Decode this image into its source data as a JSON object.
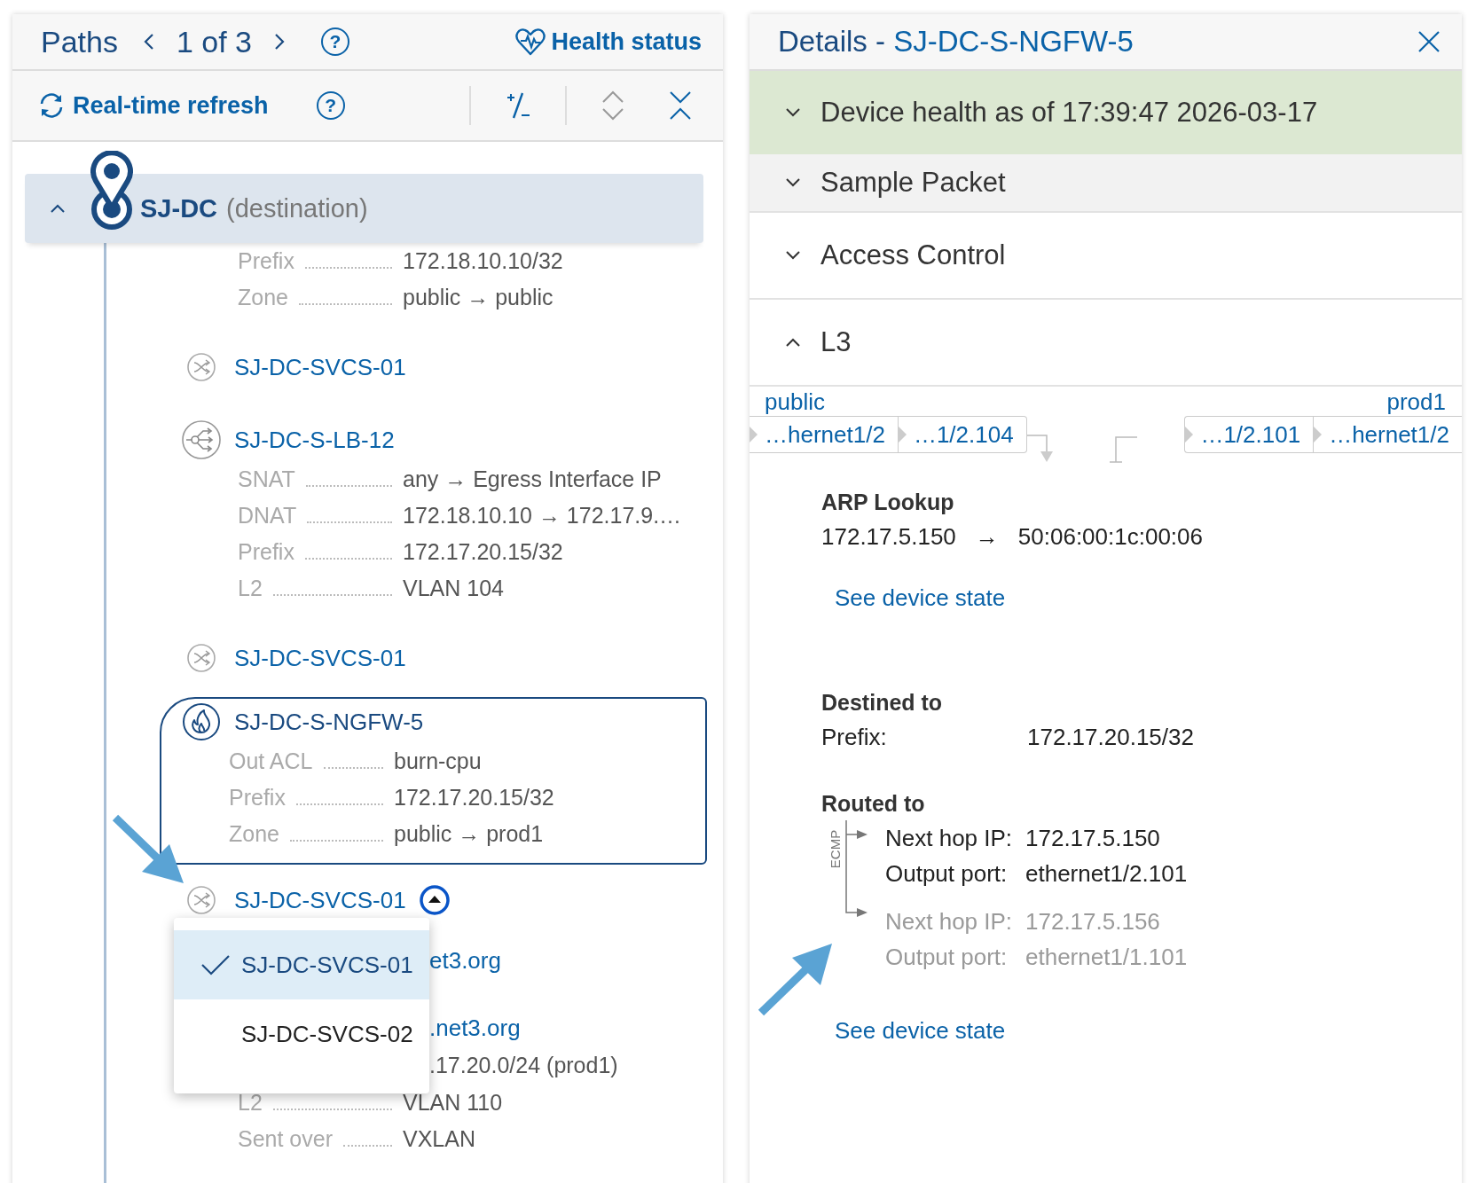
{
  "paths_panel": {
    "title": "Paths",
    "pager": "1 of 3",
    "help": "?",
    "health_link": "Health status",
    "refresh": "Real-time refresh",
    "refresh_help": "?",
    "nodes": [
      {
        "kind": "destination",
        "name": "SJ-DC",
        "role": "(destination)",
        "expanded": true,
        "attributes": [
          {
            "label": "Prefix",
            "value": "172.18.10.10/32"
          },
          {
            "label": "Zone",
            "value": "public → public"
          }
        ]
      },
      {
        "kind": "switch",
        "name": "SJ-DC-SVCS-01",
        "selected": false
      },
      {
        "kind": "load_balancer",
        "name": "SJ-DC-S-LB-12",
        "selected": false,
        "attributes": [
          {
            "label": "SNAT",
            "value": "any → Egress Interface IP"
          },
          {
            "label": "DNAT",
            "value": "172.18.10.10 → 172.17.9.…"
          },
          {
            "label": "Prefix",
            "value": "172.17.20.15/32"
          },
          {
            "label": "L2",
            "value": "VLAN 104"
          }
        ]
      },
      {
        "kind": "switch",
        "name": "SJ-DC-SVCS-01",
        "selected": false
      },
      {
        "kind": "firewall",
        "name": "SJ-DC-S-NGFW-5",
        "selected": true,
        "attributes": [
          {
            "label": "Out ACL",
            "value": "burn-cpu"
          },
          {
            "label": "Prefix",
            "value": "172.17.20.15/32"
          },
          {
            "label": "Zone",
            "value": "public → prod1"
          }
        ]
      },
      {
        "kind": "switch",
        "name": "SJ-DC-SVCS-01",
        "selected": false,
        "menu_open": true,
        "menu": [
          {
            "label": "SJ-DC-SVCS-01",
            "selected": true
          },
          {
            "label": "SJ-DC-SVCS-02",
            "selected": false
          }
        ]
      }
    ],
    "covered_rows": [
      {
        "kind": "link",
        "text": "et3.org"
      },
      {
        "kind": "link",
        "text": ".net3.org"
      },
      {
        "kind": "value",
        "text": ".17.20.0/24 (prod1)"
      }
    ],
    "trailing_attributes": [
      {
        "label": "L2",
        "value": "VLAN 110"
      },
      {
        "label": "Sent over",
        "value": "VXLAN"
      }
    ]
  },
  "details_panel": {
    "title": "Details - ",
    "device": "SJ-DC-S-NGFW-5",
    "sections": [
      {
        "title": "Device health as of 17:39:47 2026-03-17",
        "kind": "health",
        "expanded": false
      },
      {
        "title": "Sample Packet",
        "kind": "muted",
        "expanded": false
      },
      {
        "title": "Access Control",
        "kind": "plain",
        "expanded": false
      },
      {
        "title": "L3",
        "kind": "plain",
        "expanded": true
      }
    ],
    "l3": {
      "ingress_zone": "public",
      "egress_zone": "prod1",
      "ingress_ports": [
        "…hernet1/2",
        "…1/2.104"
      ],
      "egress_ports": [
        "…1/2.101",
        "…hernet1/2"
      ],
      "arp": {
        "title": "ARP Lookup",
        "ip": "172.17.5.150",
        "arrow": "→",
        "mac": "50:06:00:1c:00:06"
      },
      "link_1": "See device state",
      "destined": {
        "title": "Destined to",
        "label": "Prefix:",
        "value": "172.17.20.15/32"
      },
      "routed": {
        "title": "Routed to",
        "group": "ECMP",
        "hops": [
          {
            "ip_label": "Next hop IP:",
            "ip": "172.17.5.150",
            "port_label": "Output port:",
            "port": "ethernet1/2.101",
            "active": true
          },
          {
            "ip_label": "Next hop IP:",
            "ip": "172.17.5.156",
            "port_label": "Output port:",
            "port": "ethernet1/1.101",
            "active": false
          }
        ]
      },
      "link_2": "See device state"
    }
  }
}
